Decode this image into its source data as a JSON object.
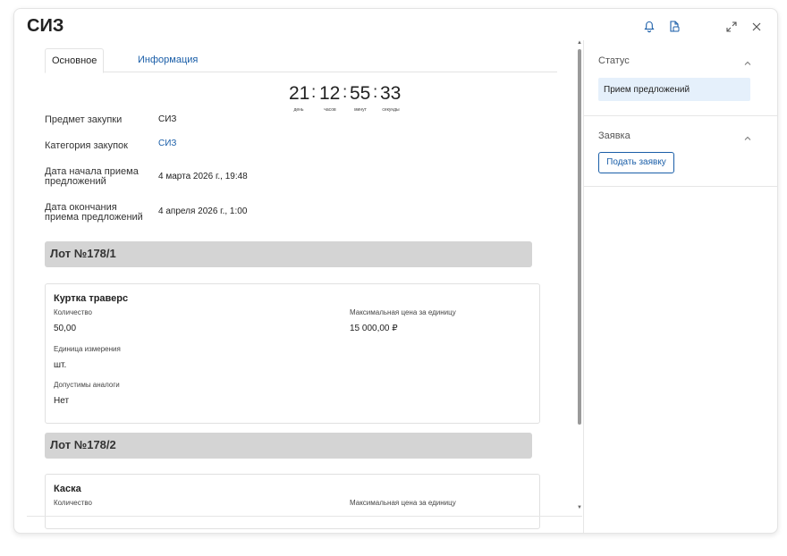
{
  "window": {
    "title": "СИЗ"
  },
  "tabs": [
    {
      "label": "Основное"
    },
    {
      "label": "Информация"
    }
  ],
  "timer": {
    "days": "21",
    "hours": "12",
    "minutes": "55",
    "seconds": "33",
    "sep": ":",
    "days_label": "день",
    "hours_label": "часов",
    "minutes_label": "минут",
    "seconds_label": "секунды"
  },
  "fields": [
    {
      "label": "Предмет закупки",
      "value": "СИЗ"
    },
    {
      "label": "Категория закупок",
      "value": "СИЗ"
    },
    {
      "label": "Дата начала приема предложений",
      "value": "4 марта 2026 г., 19:48"
    },
    {
      "label": "Дата окончания приема предложений",
      "value": "4 апреля 2026 г., 1:00"
    }
  ],
  "lots": [
    {
      "header": "Лот №178/1",
      "item": "Куртка траверс",
      "qty_label": "Количество",
      "qty_value": "50,00",
      "price_label": "Максимальная цена за единицу",
      "price_value": "15 000,00 ₽",
      "unit_label": "Единица измерения",
      "unit_value": "шт.",
      "analog_label": "Допустимы аналоги",
      "analog_value": "Нет"
    },
    {
      "header": "Лот №178/2",
      "item": "Каска",
      "qty_label": "Количество",
      "price_label": "Максимальная цена за единицу"
    }
  ],
  "sidebar": {
    "status_title": "Статус",
    "status_value": "Прием предложений",
    "application_title": "Заявка",
    "apply_button": "Подать заявку"
  },
  "icons": {
    "bell": "bell-icon",
    "doc": "document-icon",
    "expand": "expand-icon",
    "close": "close-icon",
    "chevron": "chevron-up-icon"
  },
  "colors": {
    "link": "#1a5ea8",
    "status_bg": "#e5f0fb",
    "lot_header_bg": "#d4d4d4"
  }
}
